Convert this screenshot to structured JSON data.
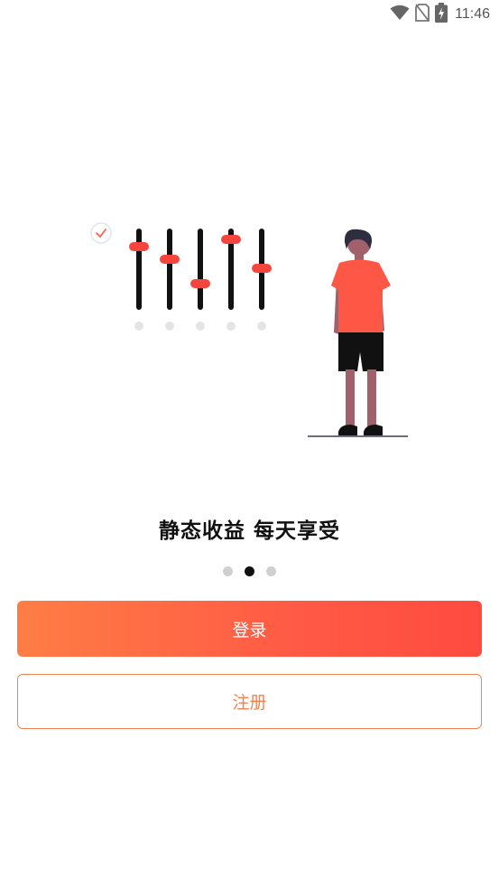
{
  "status_bar": {
    "time": "11:46",
    "icons": [
      "wifi-icon",
      "no-sim-icon",
      "battery-charging-icon"
    ]
  },
  "onboarding": {
    "slogan": "静态收益 每天享受",
    "page_count": 3,
    "current_page": 2
  },
  "actions": {
    "login_label": "登录",
    "register_label": "注册"
  },
  "colors": {
    "accent": "#ff5a45",
    "accent_start": "#ff7d45",
    "outline": "#f0834f",
    "dot_active": "#111111",
    "dot_inactive": "#cfcfcf"
  }
}
